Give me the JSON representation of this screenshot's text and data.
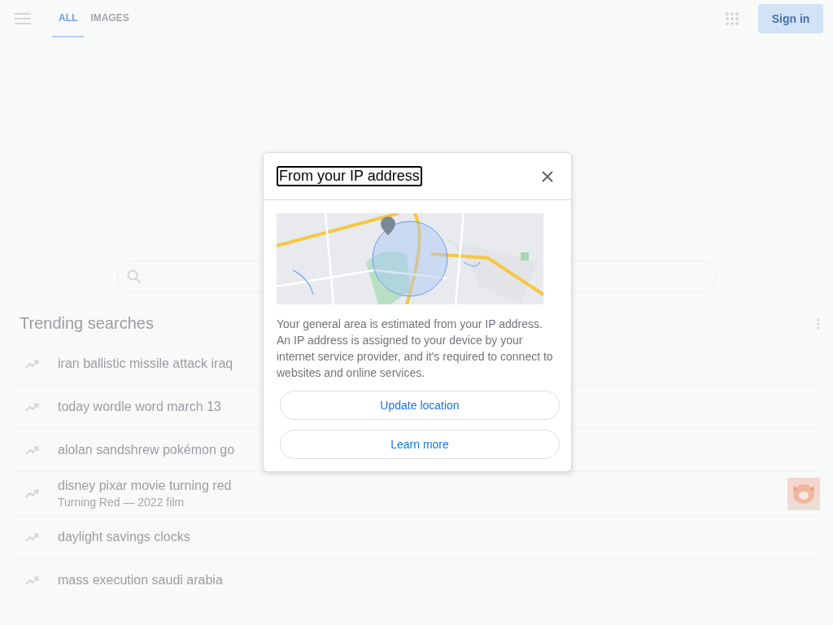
{
  "tabs": [
    {
      "label": "ALL",
      "selected": true
    },
    {
      "label": "IMAGES",
      "selected": false
    }
  ],
  "sign_in": "Sign in",
  "trending": {
    "title": "Trending searches",
    "items": [
      {
        "text": "iran ballistic missile attack iraq"
      },
      {
        "text": "today wordle word march 13"
      },
      {
        "text": "alolan sandshrew pokémon go"
      },
      {
        "text": "disney pixar movie turning red",
        "subtitle": "Turning Red — 2022 film"
      },
      {
        "text": "daylight savings clocks"
      },
      {
        "text": "mass execution saudi arabia"
      }
    ]
  },
  "dialog": {
    "title": "From your IP address",
    "body": "Your general area is estimated from your IP address. An IP address is assigned to your device by your internet service provider, and it's required to connect to websites and online services.",
    "buttons": [
      "Update location",
      "Learn more"
    ]
  }
}
